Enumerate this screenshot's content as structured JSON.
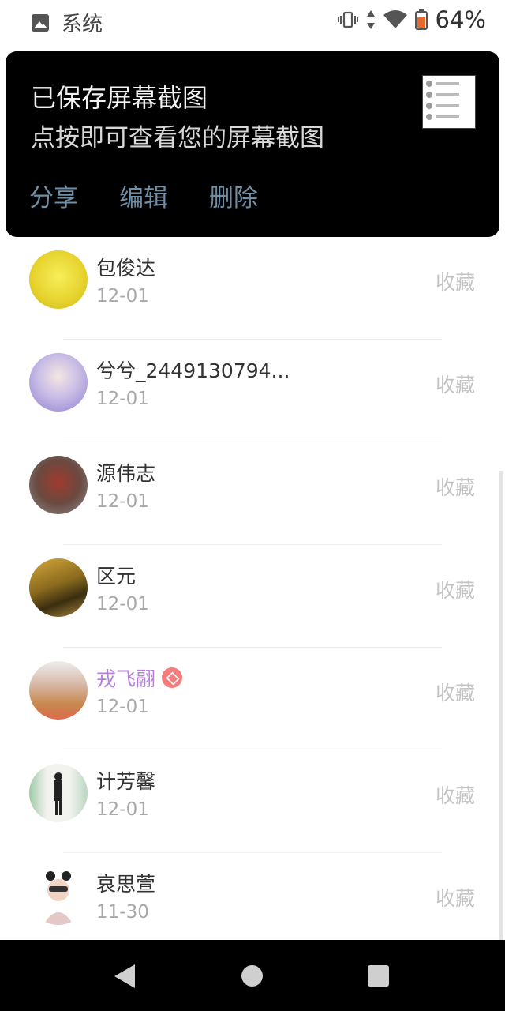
{
  "status_bar": {
    "app_label": "系统",
    "battery_percent": "64%",
    "icons": [
      "image-icon",
      "vibrate-icon",
      "data-arrows-icon",
      "wifi-icon",
      "battery-icon"
    ]
  },
  "notification": {
    "title": "已保存屏幕截图",
    "subtitle": "点按即可查看您的屏幕截图",
    "actions": {
      "share": "分享",
      "edit": "编辑",
      "delete": "删除"
    }
  },
  "contacts": [
    {
      "name": "包俊达",
      "date": "12-01",
      "action": "收藏",
      "vip": false,
      "avatar_color": "#e8de3a"
    },
    {
      "name": "兮兮_2449130794...",
      "date": "12-01",
      "action": "收藏",
      "vip": false,
      "avatar_color": "#a99ed6"
    },
    {
      "name": "源伟志",
      "date": "12-01",
      "action": "收藏",
      "vip": false,
      "avatar_color": "#7a5a5a"
    },
    {
      "name": "区元",
      "date": "12-01",
      "action": "收藏",
      "vip": false,
      "avatar_color": "#8a7a32"
    },
    {
      "name": "戎飞翮",
      "date": "12-01",
      "action": "收藏",
      "vip": true,
      "avatar_color": "#d9b4a0"
    },
    {
      "name": "计芳馨",
      "date": "12-01",
      "action": "收藏",
      "vip": false,
      "avatar_color": "#c8d8c8"
    },
    {
      "name": "哀思萱",
      "date": "11-30",
      "action": "收藏",
      "vip": false,
      "avatar_color": "#e8e0e8"
    }
  ],
  "nav": {
    "icons": [
      "back-icon",
      "home-icon",
      "recents-icon"
    ]
  }
}
